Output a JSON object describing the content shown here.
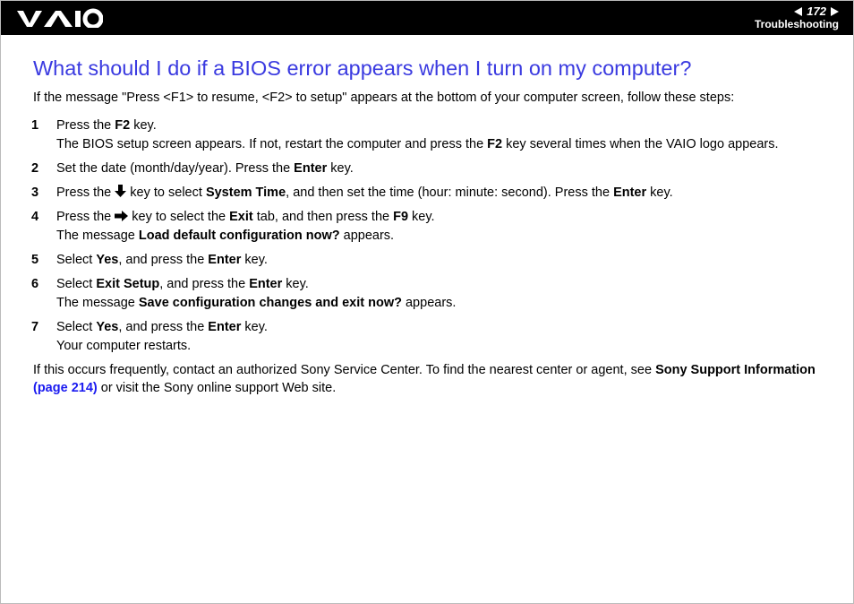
{
  "header": {
    "page_number": "172",
    "section": "Troubleshooting"
  },
  "title": "What should I do if a BIOS error appears when I turn on my computer?",
  "intro": "If the message \"Press <F1> to resume, <F2> to setup\" appears at the bottom of your computer screen, follow these steps:",
  "steps": [
    {
      "n": "1",
      "parts": [
        "Press the ",
        "F2",
        " key."
      ],
      "extra_parts": [
        "The BIOS setup screen appears. If not, restart the computer and press the ",
        "F2",
        " key several times when the VAIO logo appears."
      ]
    },
    {
      "n": "2",
      "parts": [
        "Set the date (month/day/year). Press the ",
        "Enter",
        " key."
      ]
    },
    {
      "n": "3",
      "icon": "down",
      "parts_a": [
        "Press the "
      ],
      "parts_b": [
        " key to select ",
        "System Time",
        ", and then set the time (hour: minute: second). Press the ",
        "Enter",
        " key."
      ]
    },
    {
      "n": "4",
      "icon": "right",
      "parts_a": [
        "Press the "
      ],
      "parts_b": [
        " key to select the ",
        "Exit",
        " tab, and then press the ",
        "F9",
        " key."
      ],
      "extra_parts": [
        "The message ",
        "Load default configuration now?",
        " appears."
      ]
    },
    {
      "n": "5",
      "parts": [
        "Select ",
        "Yes",
        ", and press the ",
        "Enter",
        " key."
      ]
    },
    {
      "n": "6",
      "parts": [
        "Select ",
        "Exit Setup",
        ", and press the ",
        "Enter",
        " key."
      ],
      "extra_parts": [
        "The message ",
        "Save configuration changes and exit now?",
        " appears."
      ]
    },
    {
      "n": "7",
      "parts": [
        "Select ",
        "Yes",
        ", and press the ",
        "Enter",
        " key."
      ],
      "extra_plain": "Your computer restarts."
    }
  ],
  "footer": {
    "pre": "If this occurs frequently, contact an authorized Sony Service Center. To find the nearest center or agent, see ",
    "bold1": "Sony Support Information",
    "link": " (page 214)",
    "post": " or visit the Sony online support Web site."
  }
}
